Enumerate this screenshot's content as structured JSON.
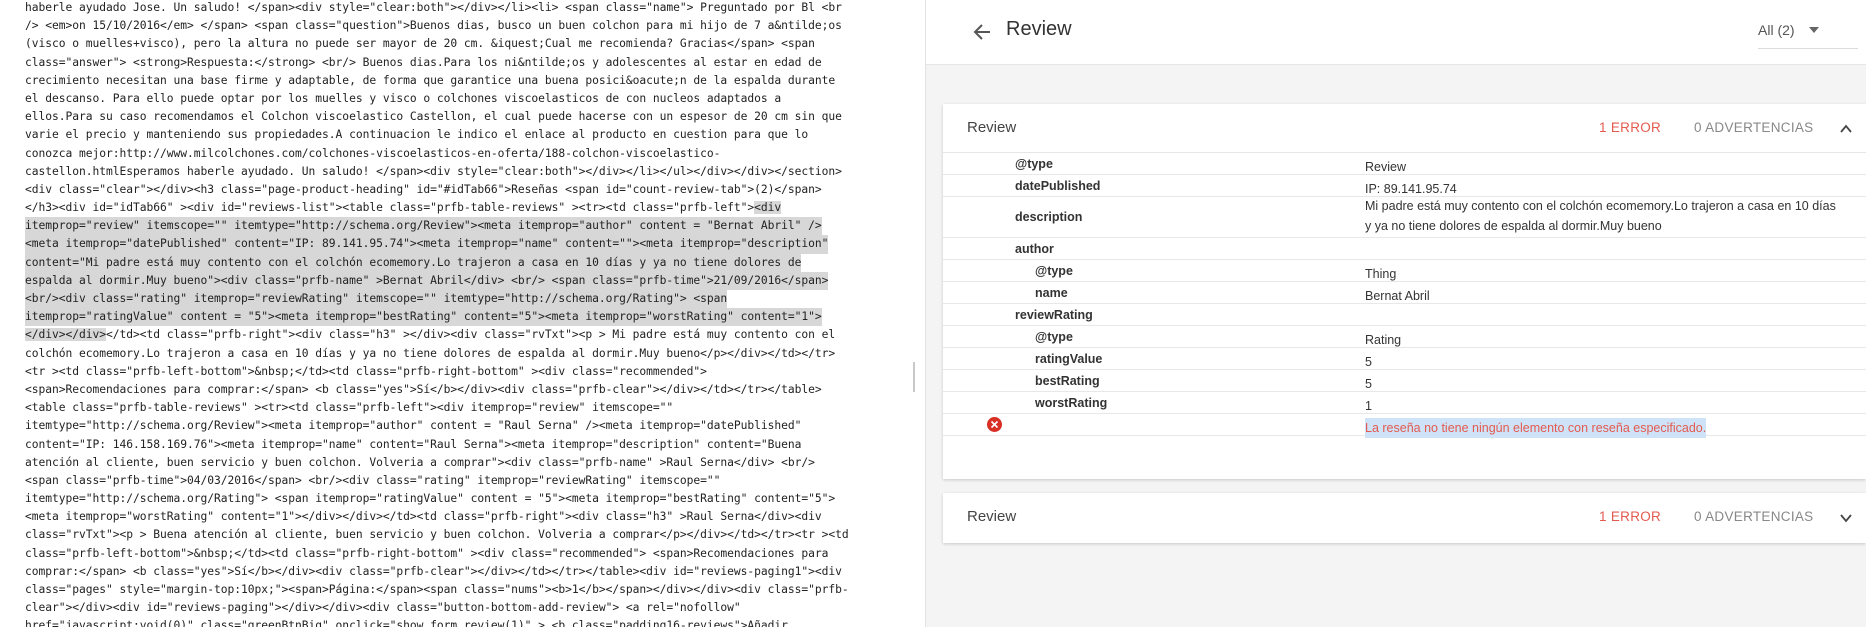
{
  "code": {
    "lines": [
      {
        "text": "haberle ayudado Jose. Un saludo! </span><div style=\"clear:both\"></div></li><li> <span class=\"name\"> Preguntado por Bl <br"
      },
      {
        "text": "/> <em>on 15/10/2016</em> </span> <span class=\"question\">Buenos dias, busco un buen colchon para mi hijo de 7 a&ntilde;os"
      },
      {
        "text": "(visco o muelles+visco), pero la altura no puede ser mayor de 20 cm. &iquest;Cual me recomienda? Gracias</span> <span"
      },
      {
        "text": "class=\"answer\"> <strong>Respuesta:</strong> <br/> Buenos dias.Para los ni&ntilde;os y adolescentes al estar en edad de"
      },
      {
        "text": "crecimiento necesitan una base firme y adaptable, de forma que garantice una buena posici&oacute;n de la espalda durante"
      },
      {
        "text": "el descanso. Para ello puede optar por los muelles y visco o colchones viscoelasticos de con nucleos adaptados a"
      },
      {
        "text": "ellos.Para su caso recomendamos el Colchon viscoelastico Castellon, el cual puede hacerse con un espesor de 20 cm sin que"
      },
      {
        "text": "varie el precio y manteniendo sus propiedades.A continuacion le indico el enlace al producto en cuestion para que lo"
      },
      {
        "text": "conozca mejor:http://www.milcolchones.com/colchones-viscoelasticos-en-oferta/188-colchon-viscoelastico-"
      },
      {
        "text": "castellon.htmlEsperamos haberle ayudado. Un saludo! </span><div style=\"clear:both\"></div></li></ul></div></div></section>"
      },
      {
        "text": "<div class=\"clear\"></div><h3 class=\"page-product-heading\" id=\"#idTab66\">Reseñas <span id=\"count-review-tab\">(2)</span>"
      },
      {
        "text": "</h3><div id=\"idTab66\" ><div id=\"reviews-list\"><table class=\"prfb-table-reviews\" ><tr><td class=\"prfb-left\">",
        "sel": "<div"
      },
      {
        "text": "",
        "sel": "itemprop=\"review\" itemscope=\"\" itemtype=\"http://schema.org/Review\"><meta itemprop=\"author\" content = \"Bernat Abril\" />",
        "full": true
      },
      {
        "text": "",
        "sel": "<meta itemprop=\"datePublished\" content=\"IP: 89.141.95.74\"><meta itemprop=\"name\" content=\"\"><meta itemprop=\"description\"",
        "full": true
      },
      {
        "text": "",
        "sel": "content=\"Mi padre está muy contento con el colchón ecomemory.Lo trajeron a casa en 10 días y ya no tiene dolores de",
        "full": true
      },
      {
        "text": "",
        "sel": "espalda al dormir.Muy bueno\"><div class=\"prfb-name\" >Bernat Abril</div> <br/> <span class=\"prfb-time\">21/09/2016</span>",
        "full": true
      },
      {
        "text": "",
        "sel": "<br/><div class=\"rating\" itemprop=\"reviewRating\" itemscope=\"\" itemtype=\"http://schema.org/Rating\"> <span",
        "full": true
      },
      {
        "text": "",
        "sel": "itemprop=\"ratingValue\" content = \"5\"><meta itemprop=\"bestRating\" content=\"5\"><meta itemprop=\"worstRating\" content=\"1\">",
        "full": true
      },
      {
        "text": "</td><td class=\"prfb-right\"><div class=\"h3\" ></div><div class=\"rvTxt\"><p > Mi padre está muy contento con el",
        "pre": "</div></div>"
      },
      {
        "text": "colchón ecomemory.Lo trajeron a casa en 10 días y ya no tiene dolores de espalda al dormir.Muy bueno</p></div></td></tr>"
      },
      {
        "text": "<tr ><td class=\"prfb-left-bottom\">&nbsp;</td><td class=\"prfb-right-bottom\" ><div class=\"recommended\">"
      },
      {
        "text": "<span>Recomendaciones para comprar:</span> <b class=\"yes\">Sí</b></div><div class=\"prfb-clear\"></div></td></tr></table>"
      },
      {
        "text": "<table class=\"prfb-table-reviews\" ><tr><td class=\"prfb-left\"><div itemprop=\"review\" itemscope=\"\""
      },
      {
        "text": "itemtype=\"http://schema.org/Review\"><meta itemprop=\"author\" content = \"Raul Serna\" /><meta itemprop=\"datePublished\""
      },
      {
        "text": "content=\"IP: 146.158.169.76\"><meta itemprop=\"name\" content=\"Raul Serna\"><meta itemprop=\"description\" content=\"Buena"
      },
      {
        "text": "atención al cliente, buen servicio y buen colchon. Volveria a comprar\"><div class=\"prfb-name\" >Raul Serna</div> <br/>"
      },
      {
        "text": "<span class=\"prfb-time\">04/03/2016</span> <br/><div class=\"rating\" itemprop=\"reviewRating\" itemscope=\"\""
      },
      {
        "text": "itemtype=\"http://schema.org/Rating\"> <span itemprop=\"ratingValue\" content = \"5\"><meta itemprop=\"bestRating\" content=\"5\">"
      },
      {
        "text": "<meta itemprop=\"worstRating\" content=\"1\"></div></div></td><td class=\"prfb-right\"><div class=\"h3\" >Raul Serna</div><div"
      },
      {
        "text": "class=\"rvTxt\"><p > Buena atención al cliente, buen servicio y buen colchon. Volveria a comprar</p></div></td></tr><tr ><td"
      },
      {
        "text": "class=\"prfb-left-bottom\">&nbsp;</td><td class=\"prfb-right-bottom\" ><div class=\"recommended\"> <span>Recomendaciones para"
      },
      {
        "text": "comprar:</span> <b class=\"yes\">Sí</b></div><div class=\"prfb-clear\"></div></td></tr></table><div id=\"reviews-paging1\"><div"
      },
      {
        "text": "class=\"pages\" style=\"margin-top:10px;\"><span>Página:</span><span class=\"nums\"><b>1</b></span></div></div><div class=\"prfb-"
      },
      {
        "text": "clear\"></div><div id=\"reviews-paging\"></div></div><div class=\"button-bottom-add-review\"> <a rel=\"nofollow\""
      },
      {
        "text": "href=\"javascript:void(0)\" class=\"greenBtnBig\" onclick=\"show_form_review(1)\" > <b class=\"padding16-reviews\">Añadir"
      }
    ]
  },
  "header": {
    "title": "Review",
    "filter_label": "All (2)"
  },
  "cards": [
    {
      "title": "Review",
      "errors": "1 ERROR",
      "warnings": "0 ADVERTENCIAS",
      "rows": [
        {
          "key": "@type",
          "value": "Review",
          "level": 1
        },
        {
          "key": "datePublished",
          "value": "IP: 89.141.95.74",
          "level": 1
        },
        {
          "key": "description",
          "value": "Mi padre está muy contento con el colchón ecomemory.Lo trajeron a casa en 10 días y ya no tiene dolores de espalda al dormir.Muy bueno",
          "level": 1,
          "tall": true
        },
        {
          "key": "author",
          "value": "",
          "level": 1
        },
        {
          "key": "@type",
          "value": "Thing",
          "level": 2
        },
        {
          "key": "name",
          "value": "Bernat Abril",
          "level": 2
        },
        {
          "key": "reviewRating",
          "value": "",
          "level": 1
        },
        {
          "key": "@type",
          "value": "Rating",
          "level": 2
        },
        {
          "key": "ratingValue",
          "value": "5",
          "level": 2
        },
        {
          "key": "bestRating",
          "value": "5",
          "level": 2
        },
        {
          "key": "worstRating",
          "value": "1",
          "level": 2
        }
      ],
      "error_message": "La reseña no tiene ningún elemento con reseña especificado."
    },
    {
      "title": "Review",
      "errors": "1 ERROR",
      "warnings": "0 ADVERTENCIAS"
    }
  ],
  "colors": {
    "error": "#e35a4f",
    "selection": "#d7d7d7"
  },
  "icons": [
    "back-arrow-icon",
    "dropdown-arrow-icon",
    "chevron-up-icon",
    "chevron-down-icon",
    "error-icon"
  ]
}
